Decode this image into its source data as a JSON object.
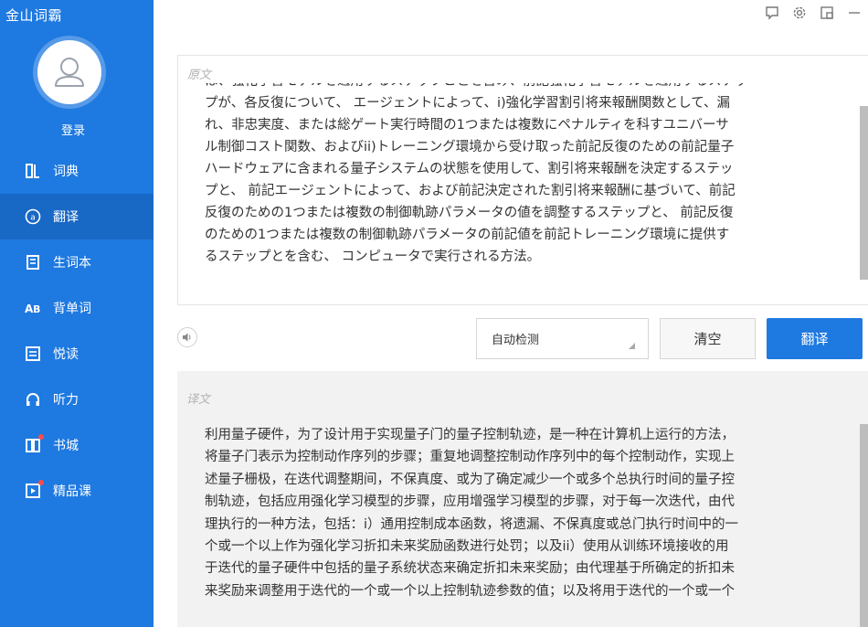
{
  "app": {
    "title": "金山词霸"
  },
  "user": {
    "login_label": "登录"
  },
  "nav": {
    "items": [
      {
        "label": "词典",
        "icon": "dictionary-icon",
        "active": false
      },
      {
        "label": "翻译",
        "icon": "translate-icon",
        "active": true
      },
      {
        "label": "生词本",
        "icon": "wordbook-icon",
        "active": false
      },
      {
        "label": "背单词",
        "icon": "memorize-icon",
        "active": false
      },
      {
        "label": "悦读",
        "icon": "reading-icon",
        "active": false
      },
      {
        "label": "听力",
        "icon": "headphones-icon",
        "active": false
      },
      {
        "label": "书城",
        "icon": "bookstore-icon",
        "active": false,
        "badge": true
      },
      {
        "label": "精品课",
        "icon": "course-icon",
        "active": false,
        "badge": true
      }
    ]
  },
  "window_controls": [
    "feedback-icon",
    "settings-icon",
    "minimode-icon",
    "minimize-icon"
  ],
  "source": {
    "label": "原文",
    "lines": [
      "は、強化学習モデルを適用するステップことを含み、前記強化学習モデルを適用するステッ",
      "プが、各反復について、 エージェントによって、i)強化学習割引将来報酬関数として、漏",
      "れ、非忠実度、または総ゲート実行時間の1つまたは複数にペナルティを科すユニバーサ",
      "ル制御コスト関数、およびii)トレーニング環境から受け取った前記反復のための前記量子",
      "ハードウェアに含まれる量子システムの状態を使用して、割引将来報酬を決定するステッ",
      "プと、 前記エージェントによって、および前記決定された割引将来報酬に基づいて、前記",
      "反復のための1つまたは複数の制御軌跡パラメータの値を調整するステップと、 前記反復",
      "のための1つまたは複数の制御軌跡パラメータの前記値を前記トレーニング環境に提供す",
      "るステップとを含む、 コンピュータで実行される方法。"
    ]
  },
  "controls": {
    "speaker_icon": "speaker-icon",
    "language_select": "自动检测",
    "clear_label": "清空",
    "translate_label": "翻译"
  },
  "result": {
    "label": "译文",
    "lines": [
      "利用量子硬件，为了设计用于实现量子门的量子控制轨迹，是一种在计算机上运行的方法，",
      "将量子门表示为控制动作序列的步骤；重复地调整控制动作序列中的每个控制动作，实现上",
      "述量子栅极，在迭代调整期间，不保真度、或为了确定减少一个或多个总执行时间的量子控",
      "制轨迹，包括应用强化学习模型的步骤，应用增强学习模型的步骤，对于每一次迭代，由代",
      "理执行的一种方法，包括：i）通用控制成本函数，将遗漏、不保真度或总门执行时间中的一",
      "个或一个以上作为强化学习折扣未来奖励函数进行处罚；以及ii）使用从训练环境接收的用",
      "于迭代的量子硬件中包括的量子系统状态来确定折扣未来奖励；由代理基于所确定的折扣未",
      "来奖励来调整用于迭代的一个或一个以上控制轨迹参数的值；以及将用于迭代的一个或一个"
    ]
  },
  "colors": {
    "accent": "#1e79e0",
    "active_nav": "#1868c5",
    "result_bg": "#f2f2f2"
  }
}
